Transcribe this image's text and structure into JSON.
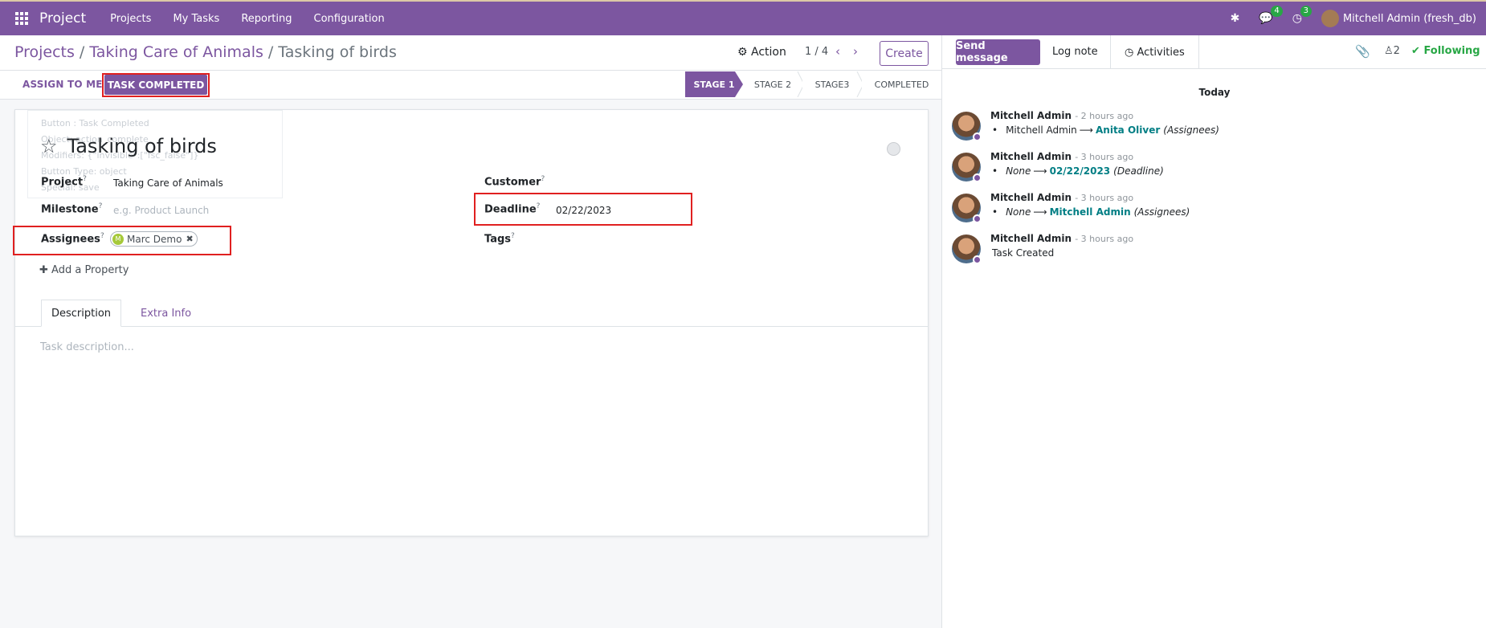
{
  "navbar": {
    "brand": "Project",
    "menu": [
      "Projects",
      "My Tasks",
      "Reporting",
      "Configuration"
    ],
    "messages_badge": "4",
    "activities_badge": "3",
    "user": "Mitchell Admin (fresh_db)"
  },
  "breadcrumb": {
    "root": "Projects",
    "project": "Taking Care of Animals",
    "current": "Tasking of birds",
    "separator": "/"
  },
  "control": {
    "action_label": "Action",
    "pager_value": "1 / 4",
    "create_label": "Create"
  },
  "statusbar": {
    "assign_label": "ASSIGN TO ME",
    "task_completed_label": "TASK COMPLETED",
    "stages": [
      "STAGE 1",
      "STAGE 2",
      "STAGE3",
      "COMPLETED"
    ],
    "active_stage": "STAGE 1"
  },
  "tooltip": {
    "line1": "Button : Task Completed",
    "line2": "Object: action_complete",
    "line3": "Modifiers: {\"invisible\":[\"fsc_false\"]}",
    "line4": "Button Type: object",
    "line5": "Special: save"
  },
  "form": {
    "title": "Tasking of birds",
    "project_label": "Project",
    "project_value": "Taking Care of Animals",
    "milestone_label": "Milestone",
    "milestone_placeholder": "e.g. Product Launch",
    "assignees_label": "Assignees",
    "assignee_initial": "M",
    "assignee_name": "Marc Demo",
    "customer_label": "Customer",
    "deadline_label": "Deadline",
    "deadline_value": "02/22/2023",
    "tags_label": "Tags",
    "help_mark": "?",
    "add_property_label": "Add a Property",
    "tabs": [
      "Description",
      "Extra Info"
    ],
    "description_placeholder": "Task description..."
  },
  "chatter": {
    "send_message_label": "Send message",
    "log_note_label": "Log note",
    "activities_label": "Activities",
    "followers_count": "2",
    "following_label": "Following",
    "date_separator": "Today",
    "messages": [
      {
        "author": "Mitchell Admin",
        "time": "- 2 hours ago",
        "old": "Mitchell Admin",
        "new": "Anita Oliver",
        "field": "(Assignees)"
      },
      {
        "author": "Mitchell Admin",
        "time": "- 3 hours ago",
        "old": "None",
        "new": "02/22/2023",
        "field": "(Deadline)"
      },
      {
        "author": "Mitchell Admin",
        "time": "- 3 hours ago",
        "old": "None",
        "new": "Mitchell Admin",
        "field": "(Assignees)"
      },
      {
        "author": "Mitchell Admin",
        "time": "- 3 hours ago",
        "body": "Task Created"
      }
    ]
  },
  "colors": {
    "brand": "#7c56a0",
    "highlight": "#e02020",
    "following": "#28a745",
    "link": "#017e84"
  }
}
